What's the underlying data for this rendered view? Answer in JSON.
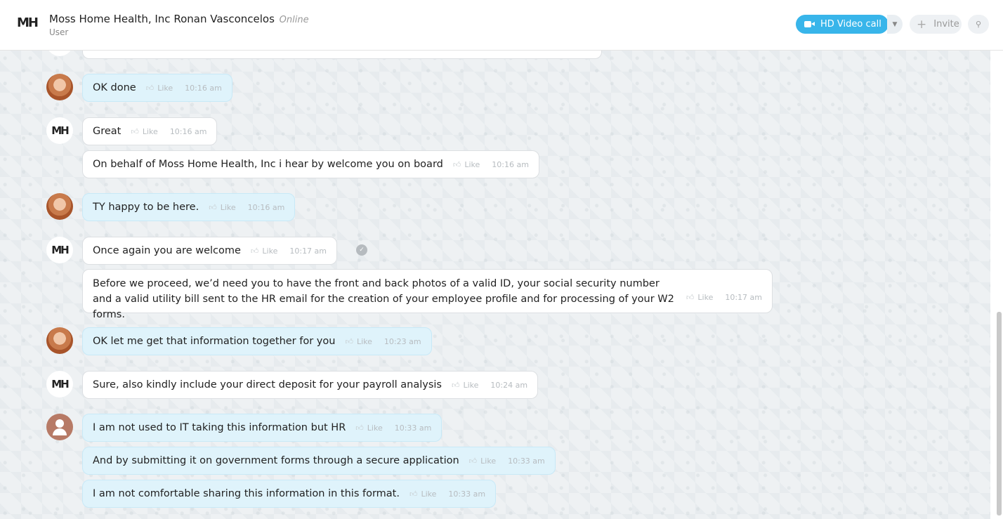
{
  "header": {
    "logo": "MH",
    "title": "Moss Home Health, Inc Ronan Vasconcelos",
    "status": "Online",
    "subtitle": "User",
    "hd_video_label": "HD Video call",
    "invite_label": "Invite",
    "icons": {
      "video": "video-camera-icon",
      "caret": "chevron-down-icon",
      "plus": "plus-icon",
      "search": "search-icon"
    }
  },
  "messages": [
    {
      "sender": "user",
      "avatar": "photo",
      "text": "OK done",
      "like": "Like",
      "time": "10:16 am"
    },
    {
      "sender": "mh",
      "avatar": "MH",
      "text": "Great",
      "like": "Like",
      "time": "10:16 am"
    },
    {
      "sender": "mh",
      "avatar": "",
      "text": "On behalf of Moss Home Health, Inc i hear by welcome you on board",
      "like": "Like",
      "time": "10:16 am"
    },
    {
      "sender": "user",
      "avatar": "photo",
      "text": "TY happy to be here.",
      "like": "Like",
      "time": "10:16 am"
    },
    {
      "sender": "mh",
      "avatar": "MH",
      "text": "Once again you are welcome",
      "like": "Like",
      "time": "10:17 am"
    },
    {
      "sender": "mh",
      "avatar": "",
      "text": "Before we proceed, we’d need you to have the front and back photos of a valid ID, your social security number and a valid utility bill sent to the HR email for the creation of your employee profile and for processing of your W2 forms.",
      "like": "Like",
      "time": "10:17 am"
    },
    {
      "sender": "user",
      "avatar": "photo",
      "text": "OK let me get that information together for you",
      "like": "Like",
      "time": "10:23 am"
    },
    {
      "sender": "mh",
      "avatar": "MH",
      "text": "Sure, also kindly include your direct deposit for your payroll analysis",
      "like": "Like",
      "time": "10:24 am"
    },
    {
      "sender": "user2",
      "avatar": "default",
      "text": "I am not used to IT taking this information but HR",
      "like": "Like",
      "time": "10:33 am"
    },
    {
      "sender": "user2",
      "avatar": "",
      "text": "And by submitting it on government forms through a secure application",
      "like": "Like",
      "time": "10:33 am"
    },
    {
      "sender": "user2",
      "avatar": "",
      "text": "I am not comfortable sharing this information in this format.",
      "like": "Like",
      "time": "10:33 am"
    }
  ],
  "colors": {
    "accent": "#38b5ea",
    "outgoing_bubble": "#dff3fb",
    "incoming_bubble": "#ffffff",
    "chat_bg": "#eef1f3"
  }
}
